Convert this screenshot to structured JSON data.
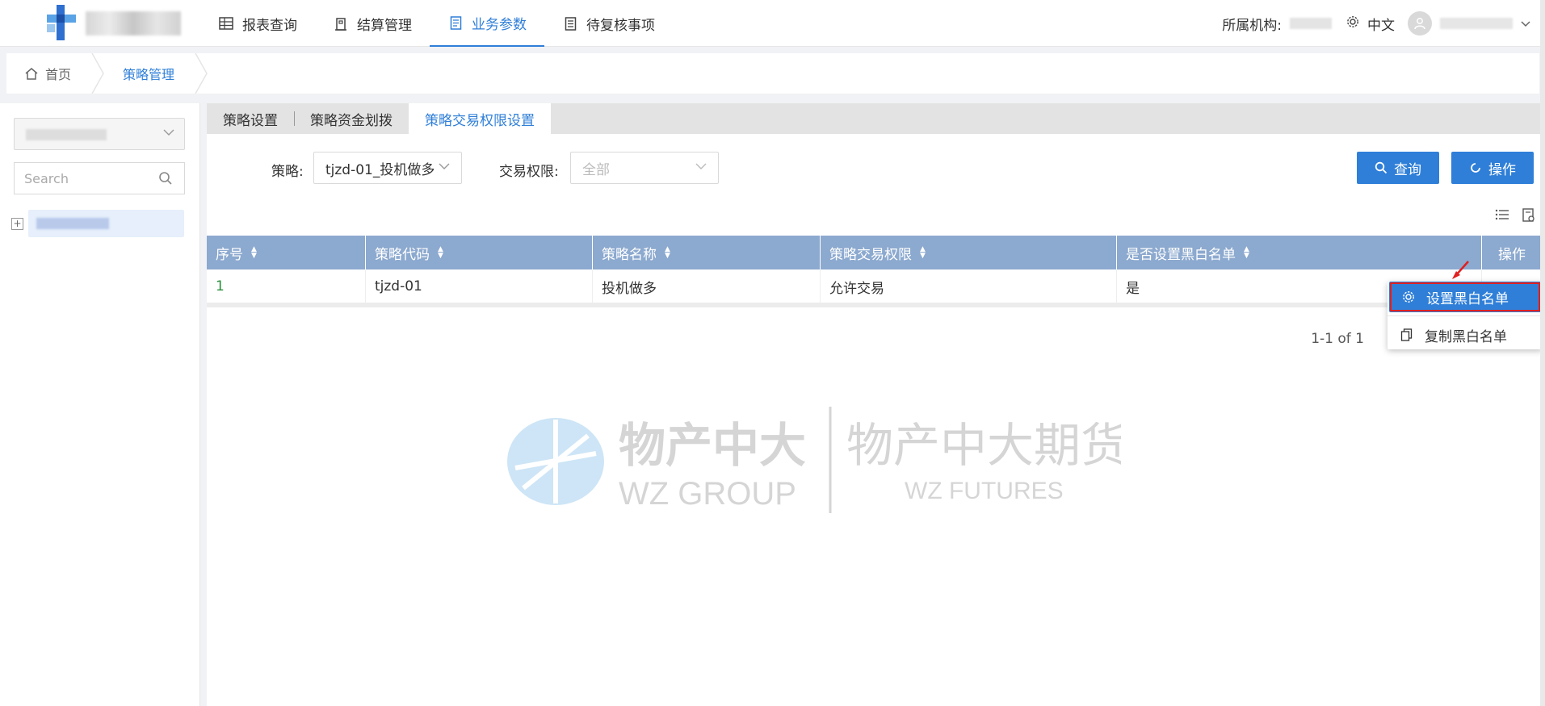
{
  "colors": {
    "accent": "#2f7fd8",
    "table_header": "#8ca9cf",
    "highlight_outline": "#e02020"
  },
  "nav": {
    "items": [
      {
        "label": "报表查询",
        "icon": "table-icon",
        "active": false
      },
      {
        "label": "结算管理",
        "icon": "building-icon",
        "active": false
      },
      {
        "label": "业务参数",
        "icon": "document-icon",
        "active": true
      },
      {
        "label": "待复核事项",
        "icon": "checklist-icon",
        "active": false
      }
    ]
  },
  "header": {
    "org_label": "所属机构:",
    "language": "中文"
  },
  "breadcrumb": {
    "home": "首页",
    "current": "策略管理"
  },
  "sidebar": {
    "search_placeholder": "Search",
    "tree_toggle": "+"
  },
  "tabs": [
    {
      "label": "策略设置",
      "active": false
    },
    {
      "label": "策略资金划拨",
      "active": false
    },
    {
      "label": "策略交易权限设置",
      "active": true
    }
  ],
  "filters": {
    "strategy_label": "策略:",
    "strategy_value": "tjzd-01_投机做多",
    "permission_label": "交易权限:",
    "permission_value": "全部",
    "query_button": "查询",
    "action_button": "操作"
  },
  "table": {
    "headers": [
      "序号",
      "策略代码",
      "策略名称",
      "策略交易权限",
      "是否设置黑白名单",
      "操作"
    ],
    "rows": [
      [
        "1",
        "tjzd-01",
        "投机做多",
        "允许交易",
        "是"
      ]
    ]
  },
  "pagination": {
    "summary": "1-1 of 1"
  },
  "menu": {
    "items": [
      {
        "label": "设置黑白名单",
        "icon": "gear-icon"
      },
      {
        "label": "复制黑白名单",
        "icon": "copy-icon"
      }
    ]
  },
  "watermark": {
    "cn_left": "物产中大",
    "en_left": "WZ GROUP",
    "cn_right": "物产中大期货",
    "en_right": "WZ FUTURES"
  }
}
